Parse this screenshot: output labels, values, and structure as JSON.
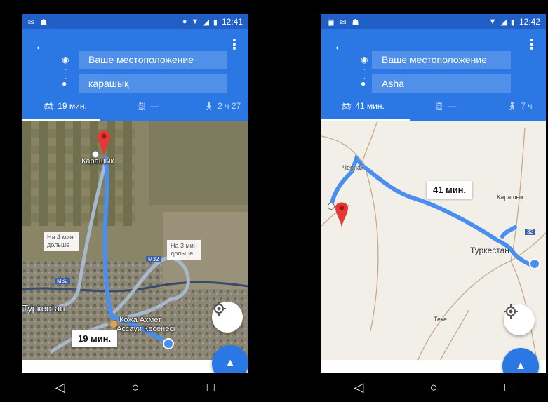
{
  "left": {
    "status": {
      "time": "12:41"
    },
    "route": {
      "from": "Ваше местоположение",
      "to": "карашық"
    },
    "modes": {
      "drive": "19 мин.",
      "transit": "—",
      "walk": "2 ч 27"
    },
    "map": {
      "main_label": "19 мин.",
      "alt1": [
        "На 4 мин.",
        "дольше"
      ],
      "alt2": [
        "На 3 мин",
        "дольше"
      ],
      "place_top": "Карашык",
      "place_city": "Туркестан",
      "place_poi_1": "Кожа Ахмет",
      "place_poi_2": "Ассауи Кесенесі",
      "road_1": "M32",
      "road_2": "M32"
    }
  },
  "right": {
    "status": {
      "time": "12:42"
    },
    "route": {
      "from": "Ваше местоположение",
      "to": "Asha"
    },
    "modes": {
      "drive": "41 мин.",
      "transit": "—",
      "walk": "7 ч"
    },
    "map": {
      "main_label": "41 мин.",
      "place_chernak": "Чернак",
      "place_karashyk": "Карашык",
      "place_city": "Туркестан",
      "place_teke": "Теке",
      "road_1": "32"
    }
  },
  "colors": {
    "appbar": "#2b78e4",
    "statusbar": "#1f5fc6",
    "route": "#4a8ef0",
    "alt_route": "#a8b8cc",
    "pin": "#e53935"
  }
}
